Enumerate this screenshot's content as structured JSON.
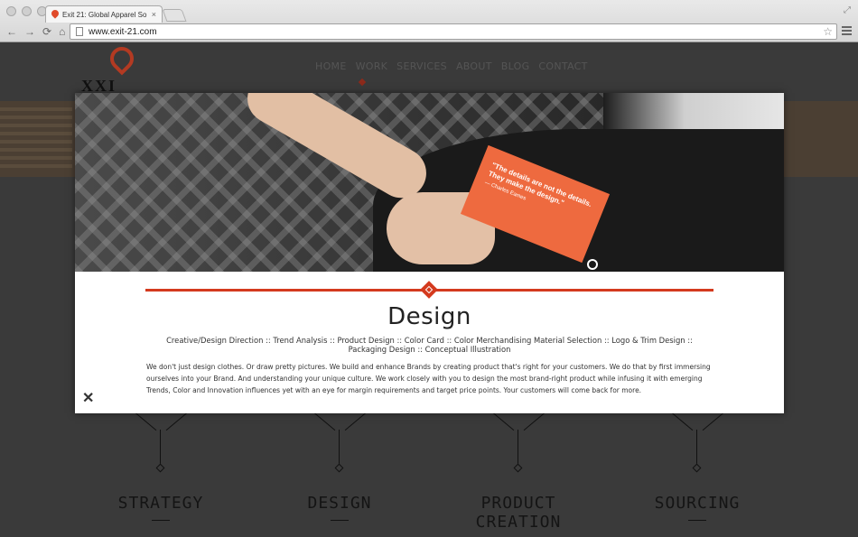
{
  "browser": {
    "tab_title": "Exit 21: Global Apparel So",
    "tab_close": "×",
    "url": "www.exit-21.com",
    "nav_back": "←",
    "nav_forward": "→",
    "nav_reload": "⟳",
    "nav_home": "⌂",
    "star": "☆",
    "fullscreen": "⤢"
  },
  "site": {
    "logo_text": "XXI",
    "nav": [
      "HOME",
      "WORK",
      "SERVICES",
      "ABOUT",
      "BLOG",
      "CONTACT"
    ],
    "active_nav": "WORK",
    "services": [
      "STRATEGY",
      "DESIGN",
      "PRODUCT CREATION",
      "SOURCING"
    ]
  },
  "modal": {
    "card_quote": "\"The details are not the details. They make the design.\"",
    "card_author": "— Charles Eames",
    "title": "Design",
    "subtitle": "Creative/Design Direction :: Trend Analysis :: Product Design :: Color Card :: Color Merchandising Material Selection :: Logo & Trim Design :: Packaging Design :: Conceptual Illustration",
    "body": "We don't just design clothes. Or draw pretty pictures. We build and enhance Brands by creating product that's right for your customers. We do that by first immersing ourselves into your Brand. And understanding your unique culture. We work closely with you to design the most brand-right product while infusing it with emerging Trends, Color and Innovation influences yet with an eye for margin requirements and target price points. Your customers will come back for more.",
    "close": "✕"
  },
  "colors": {
    "accent": "#d43a1e",
    "card": "#ee6a3f",
    "page_bg": "#3a3a3a"
  }
}
